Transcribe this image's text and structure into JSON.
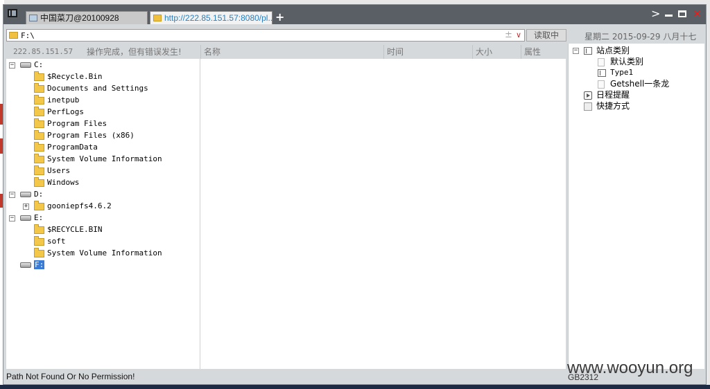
{
  "tabs": [
    {
      "label": "中国菜刀@20100928"
    },
    {
      "label": "http://222.85.151.57:8080/pl..."
    }
  ],
  "newtab_label": "+",
  "address": {
    "value": "F:\\",
    "plus": "±"
  },
  "read_button": "读取中",
  "datetime": "星期二 2015-09-29 八月十七",
  "server_ip": "222.85.151.57",
  "status_text": "操作完成，但有错误发生!",
  "columns": [
    "名称",
    "时间",
    "大小",
    "属性"
  ],
  "tree": [
    {
      "label": "C:",
      "type": "drive",
      "expanded": true
    },
    {
      "label": "$Recycle.Bin",
      "type": "folder"
    },
    {
      "label": "Documents and Settings",
      "type": "folder"
    },
    {
      "label": "inetpub",
      "type": "folder"
    },
    {
      "label": "PerfLogs",
      "type": "folder"
    },
    {
      "label": "Program Files",
      "type": "folder"
    },
    {
      "label": "Program Files (x86)",
      "type": "folder"
    },
    {
      "label": "ProgramData",
      "type": "folder"
    },
    {
      "label": "System Volume Information",
      "type": "folder"
    },
    {
      "label": "Users",
      "type": "folder"
    },
    {
      "label": "Windows",
      "type": "folder"
    },
    {
      "label": "D:",
      "type": "drive",
      "expanded": true
    },
    {
      "label": "gooniepfs4.6.2",
      "type": "folder",
      "collapsed": true
    },
    {
      "label": "E:",
      "type": "drive",
      "expanded": true
    },
    {
      "label": "$RECYCLE.BIN",
      "type": "folder"
    },
    {
      "label": "soft",
      "type": "folder"
    },
    {
      "label": "System Volume Information",
      "type": "folder"
    },
    {
      "label": "F:",
      "type": "drive",
      "selected": true
    }
  ],
  "site_tree": {
    "root": "站点类别",
    "children": [
      "默认类别",
      "Type1",
      "Getshell一条龙"
    ],
    "schedule": "日程提醒",
    "shortcuts": "快捷方式"
  },
  "status_message": "Path Not Found Or No Permission!",
  "encoding": "GB2312",
  "watermark": "www.wooyun.org",
  "colors": {
    "titlebar": "#5a5f66",
    "selection": "#3a7bd5",
    "folder": "#f3c74a",
    "close": "#e02020"
  }
}
